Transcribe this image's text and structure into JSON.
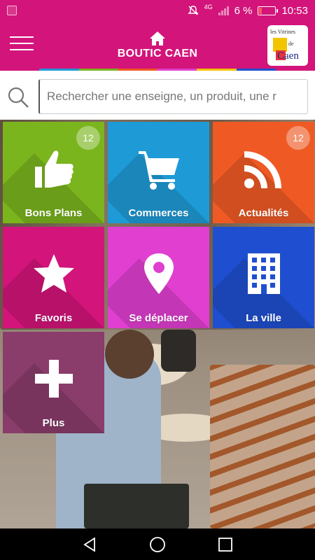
{
  "status_bar": {
    "network": "4G",
    "battery": "6 %",
    "time": "10:53"
  },
  "header": {
    "title": "BOUTIC CAEN",
    "logo": {
      "line1": "les Vitrines",
      "line2": "de",
      "line3": "Caen"
    }
  },
  "search": {
    "placeholder": "Rechercher une enseigne, un produit, une r"
  },
  "tiles": [
    {
      "label": "Bons Plans",
      "icon": "thumbs-up-icon",
      "color": "#7ab51d",
      "badge": "12"
    },
    {
      "label": "Commerces",
      "icon": "cart-icon",
      "color": "#1e9ad6",
      "badge": ""
    },
    {
      "label": "Actualités",
      "icon": "rss-icon",
      "color": "#ef5a24",
      "badge": "12"
    },
    {
      "label": "Favoris",
      "icon": "star-icon",
      "color": "#d3147a",
      "badge": ""
    },
    {
      "label": "Se déplacer",
      "icon": "map-pin-icon",
      "color": "#e03fd0",
      "badge": ""
    },
    {
      "label": "La ville",
      "icon": "building-icon",
      "color": "#1f4fd0",
      "badge": ""
    },
    {
      "label": "Plus",
      "icon": "plus-icon",
      "color": "#8a3c6a",
      "badge": ""
    }
  ],
  "colors": {
    "brand": "#d3147a",
    "strip": [
      "#d3147a",
      "#1e9ad6",
      "#7ab51d",
      "#ef5a24",
      "#e03fd0",
      "#f3c400",
      "#1f4fd0",
      "#d3147a"
    ]
  }
}
